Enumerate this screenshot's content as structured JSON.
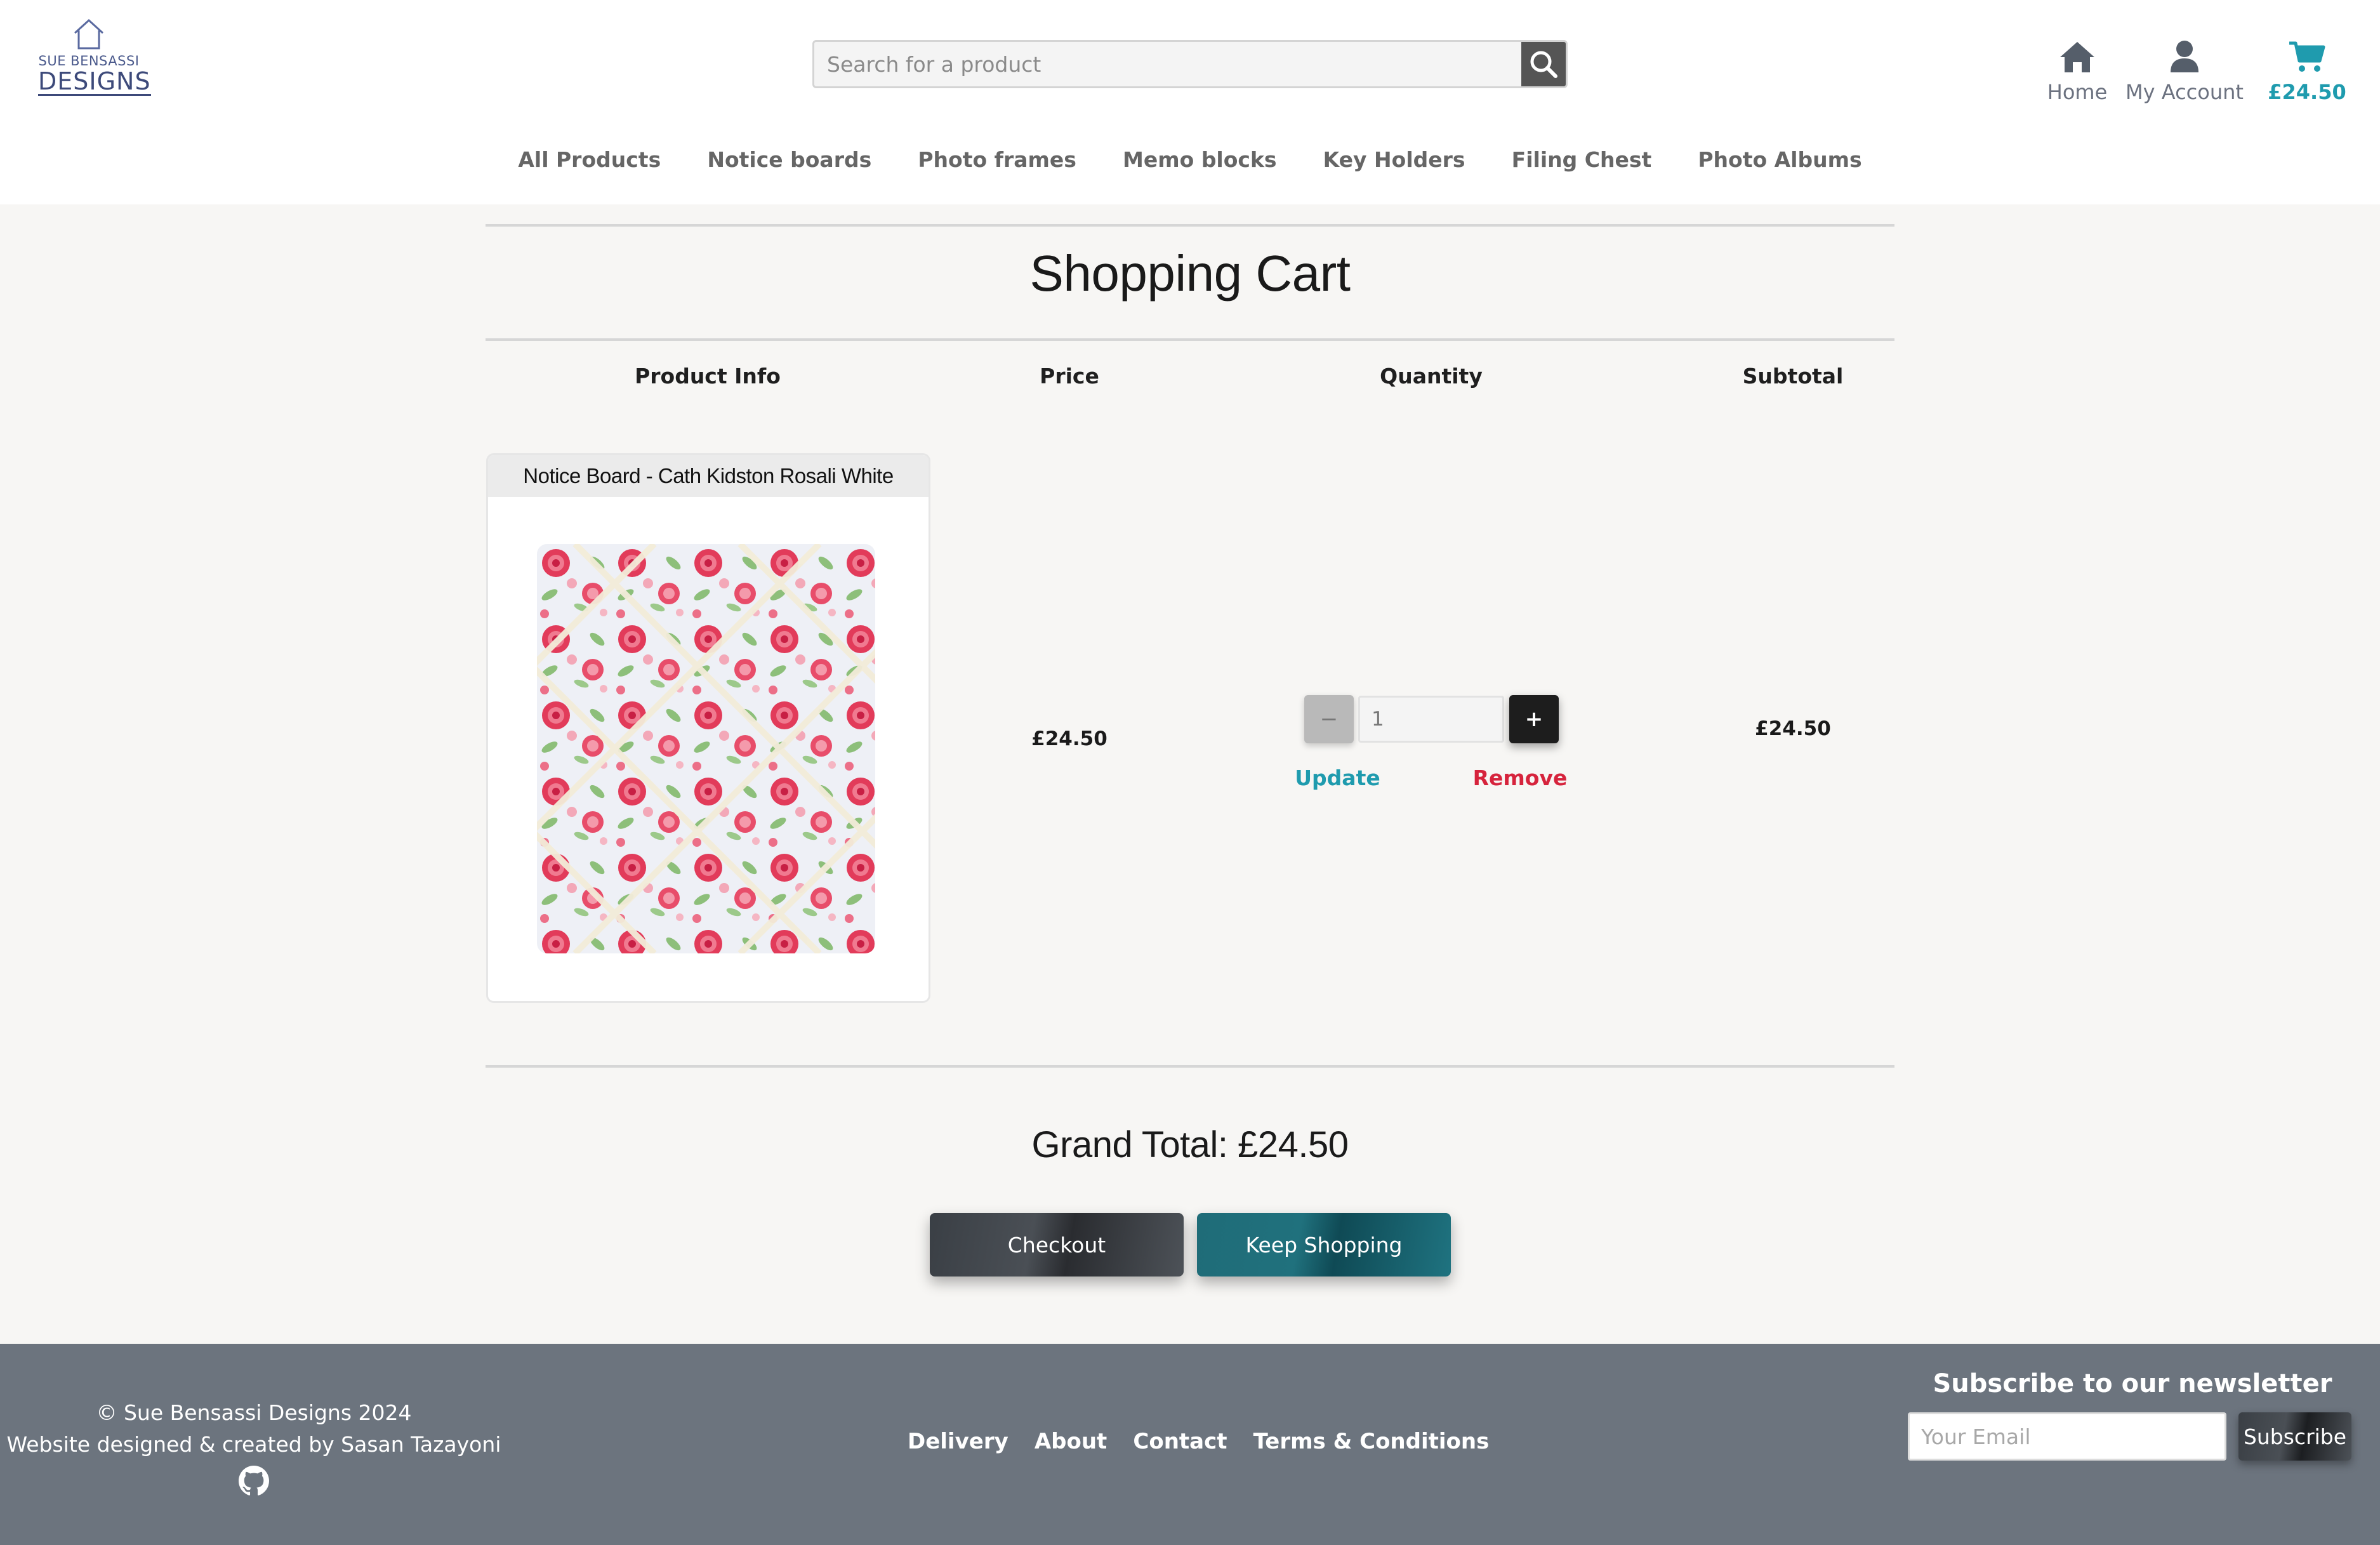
{
  "brand": {
    "line1": "SUE BENSASSI",
    "line2": "DESIGNS"
  },
  "search": {
    "placeholder": "Search for a product"
  },
  "header_links": {
    "home": "Home",
    "account": "My Account",
    "cart_total": "£24.50"
  },
  "nav": [
    "All Products",
    "Notice boards",
    "Photo frames",
    "Memo blocks",
    "Key Holders",
    "Filing Chest",
    "Photo Albums"
  ],
  "cart": {
    "title": "Shopping Cart",
    "columns": {
      "product": "Product Info",
      "price": "Price",
      "quantity": "Quantity",
      "subtotal": "Subtotal"
    },
    "items": [
      {
        "name": "Notice Board - Cath Kidston Rosali White",
        "price": "£24.50",
        "quantity": "1",
        "subtotal": "£24.50",
        "minus": "−",
        "plus": "+",
        "update": "Update",
        "remove": "Remove"
      }
    ],
    "grand_total": "Grand Total: £24.50",
    "checkout": "Checkout",
    "keep_shopping": "Keep Shopping"
  },
  "footer": {
    "copyright": "© Sue Bensassi Designs 2024",
    "credit": "Website designed & created by Sasan Tazayoni",
    "links": [
      "Delivery",
      "About",
      "Contact",
      "Terms & Conditions"
    ],
    "newsletter": {
      "title": "Subscribe to our newsletter",
      "placeholder": "Your Email",
      "button": "Subscribe"
    }
  },
  "colors": {
    "accent": "#1f9bae",
    "remove": "#d6233c",
    "footer_bg": "#6c747e"
  },
  "icons": [
    "home-icon",
    "user-icon",
    "cart-icon",
    "search-icon",
    "github-icon"
  ]
}
